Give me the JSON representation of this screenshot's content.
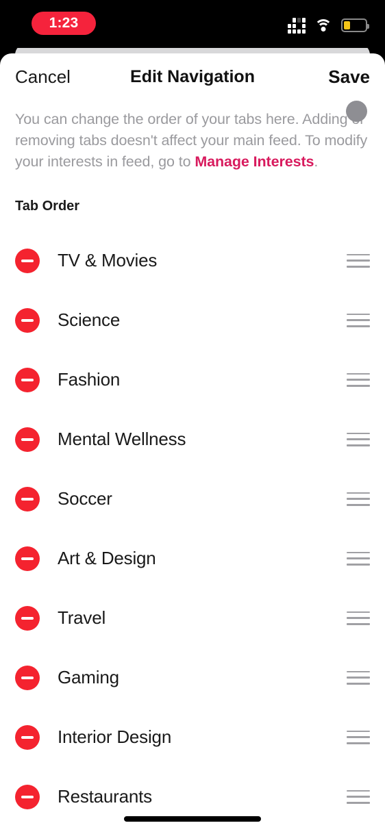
{
  "status_bar": {
    "time": "1:23",
    "time_pill_color": "#F5233C",
    "cellular_icon": "cellular-dots-icon",
    "wifi_icon": "wifi-icon",
    "battery_icon": "battery-icon",
    "battery_level_percent": 30,
    "battery_fill_color": "#F5C518"
  },
  "header": {
    "cancel_label": "Cancel",
    "title": "Edit Navigation",
    "save_label": "Save"
  },
  "description": {
    "text_before": "You can change the order of your tabs here. Adding or removing tabs doesn't affect your main feed. To modify your interests in feed, go to ",
    "link_label": "Manage Interests",
    "text_after": ".",
    "link_color": "#D81B5E"
  },
  "section": {
    "title": "Tab Order"
  },
  "tabs": [
    {
      "label": "TV & Movies",
      "remove_icon": "minus-circle-icon",
      "drag_icon": "drag-handle-icon"
    },
    {
      "label": "Science",
      "remove_icon": "minus-circle-icon",
      "drag_icon": "drag-handle-icon"
    },
    {
      "label": "Fashion",
      "remove_icon": "minus-circle-icon",
      "drag_icon": "drag-handle-icon"
    },
    {
      "label": "Mental Wellness",
      "remove_icon": "minus-circle-icon",
      "drag_icon": "drag-handle-icon"
    },
    {
      "label": "Soccer",
      "remove_icon": "minus-circle-icon",
      "drag_icon": "drag-handle-icon"
    },
    {
      "label": "Art & Design",
      "remove_icon": "minus-circle-icon",
      "drag_icon": "drag-handle-icon"
    },
    {
      "label": "Travel",
      "remove_icon": "minus-circle-icon",
      "drag_icon": "drag-handle-icon"
    },
    {
      "label": "Gaming",
      "remove_icon": "minus-circle-icon",
      "drag_icon": "drag-handle-icon"
    },
    {
      "label": "Interior Design",
      "remove_icon": "minus-circle-icon",
      "drag_icon": "drag-handle-icon"
    },
    {
      "label": "Restaurants",
      "remove_icon": "minus-circle-icon",
      "drag_icon": "drag-handle-icon"
    }
  ],
  "colors": {
    "accent_red": "#F4232F",
    "link_pink": "#D81B5E",
    "text_primary": "#1a1a1a",
    "text_muted": "#9a9a9e"
  }
}
